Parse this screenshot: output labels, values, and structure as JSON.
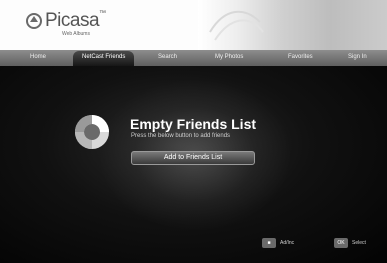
{
  "app": {
    "logo_text": "Picasa",
    "logo_tm": "™",
    "logo_subtitle": "Web Albums"
  },
  "nav": {
    "tabs": [
      {
        "label": "Home"
      },
      {
        "label": "NetCast Friends",
        "active": true
      },
      {
        "label": "Search"
      },
      {
        "label": "My Photos"
      },
      {
        "label": "Favorites"
      },
      {
        "label": "Sign In"
      }
    ]
  },
  "main": {
    "title": "Empty Friends List",
    "subtitle": "Press the below button to add friends",
    "add_button_label": "Add to Friends List"
  },
  "footer": {
    "legend": [
      {
        "key": "■",
        "label": "Ad/Inc"
      },
      {
        "key": "OK",
        "label": "Select"
      }
    ]
  },
  "colors": {
    "nav_bar": "#6f6f6f",
    "active_tab": "#1e1e1e",
    "content_bg": "#0a0a0a",
    "title_text": "#ffffff"
  }
}
